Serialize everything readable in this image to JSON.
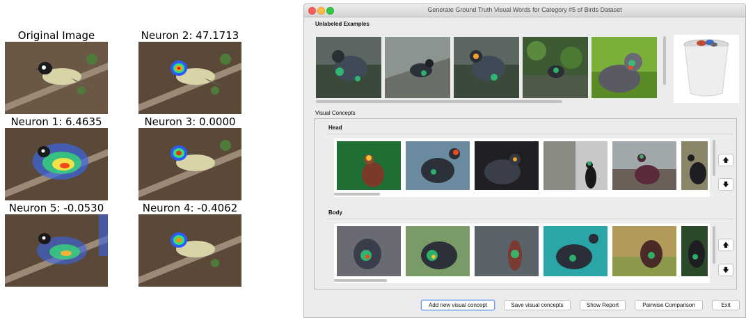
{
  "figure": {
    "titles": [
      "Original Image",
      "Neuron 2: 47.1713",
      "Neuron 1: 6.4635",
      "Neuron 3: 0.0000",
      "Neuron 5: -0.0530",
      "Neuron 4: -0.4062"
    ]
  },
  "window": {
    "title": "Generate Ground Truth Visual Words for Category #5 of  Birds Dataset"
  },
  "unlabeled": {
    "label": "Unlabeled Examples",
    "count": 5
  },
  "visual_concepts": {
    "label": "Visual Concepts",
    "groups": [
      {
        "name": "Head",
        "count": 6
      },
      {
        "name": "Body",
        "count": 6
      }
    ]
  },
  "arrows": {
    "up": "🡅",
    "down": "🡇"
  },
  "buttons": {
    "add": "Add new visual concept",
    "save": "Save visual concepts",
    "report": "Show Report",
    "pairwise": "Pairwise Comparison",
    "exit": "Exit"
  },
  "icons": [
    "trash-icon",
    "up-arrow-icon",
    "down-arrow-icon"
  ]
}
